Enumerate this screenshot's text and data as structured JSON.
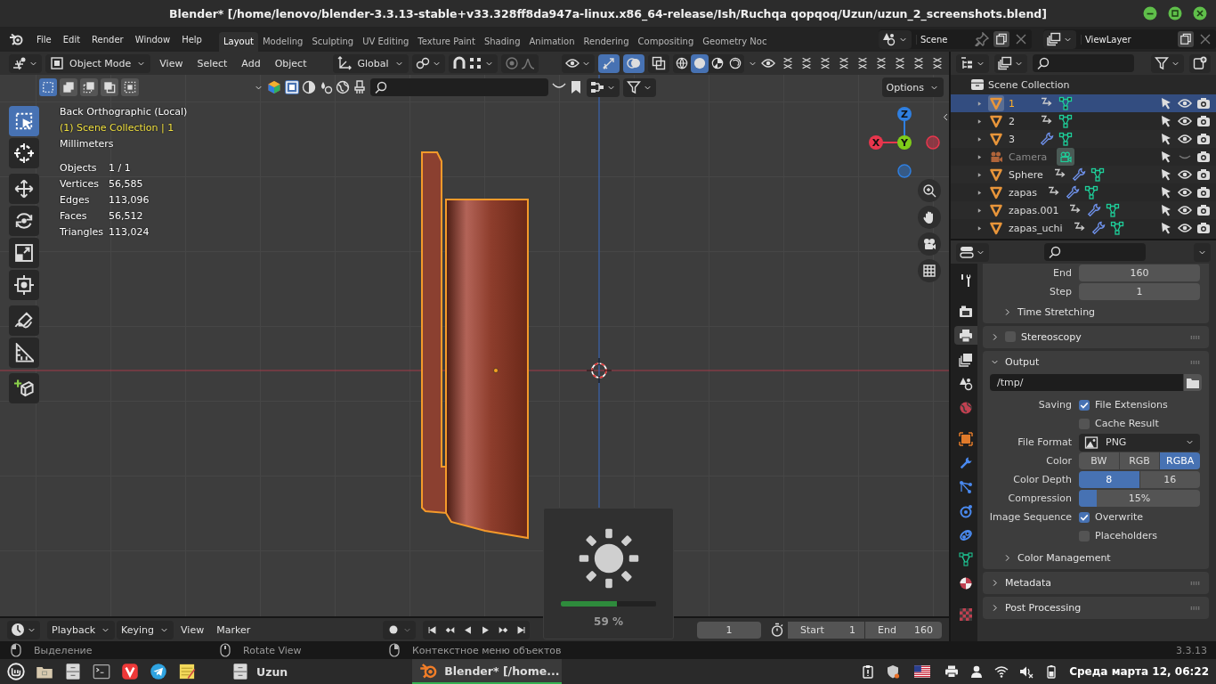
{
  "window": {
    "title": "Blender* [/home/lenovo/blender-3.3.13-stable+v33.328ff8da947a-linux.x86_64-release/Ish/Ruchqa qopqoq/Uzun/uzun_2_screenshots.blend]"
  },
  "menu": [
    "File",
    "Edit",
    "Render",
    "Window",
    "Help"
  ],
  "workspaces": [
    {
      "label": "Layout",
      "selected": true
    },
    {
      "label": "Modeling",
      "selected": false
    },
    {
      "label": "Sculpting",
      "selected": false
    },
    {
      "label": "UV Editing",
      "selected": false
    },
    {
      "label": "Texture Paint",
      "selected": false
    },
    {
      "label": "Shading",
      "selected": false
    },
    {
      "label": "Animation",
      "selected": false
    },
    {
      "label": "Rendering",
      "selected": false
    },
    {
      "label": "Compositing",
      "selected": false
    },
    {
      "label": "Geometry Noc",
      "selected": false
    }
  ],
  "scene": {
    "name": "Scene"
  },
  "view_layer": {
    "name": "ViewLayer"
  },
  "viewport": {
    "mode": "Object Mode",
    "menus": [
      "View",
      "Select",
      "Add",
      "Object"
    ],
    "orientation": "Global",
    "options": "Options",
    "shading": [
      {
        "kind": "wireframe",
        "selected": false
      },
      {
        "kind": "solid",
        "selected": true
      },
      {
        "kind": "material",
        "selected": false
      },
      {
        "kind": "rendered",
        "selected": false
      }
    ],
    "select_modes": [
      {
        "kind": "set",
        "selected": true
      },
      {
        "kind": "extend",
        "selected": false
      },
      {
        "kind": "subtract",
        "selected": false
      },
      {
        "kind": "invert",
        "selected": false
      },
      {
        "kind": "intersect",
        "selected": false
      }
    ],
    "info": {
      "view": "Back Orthographic (Local)",
      "collection": "(1) Scene Collection | 1",
      "units": "Millimeters",
      "stats": [
        {
          "label": "Objects",
          "value": "1 / 1"
        },
        {
          "label": "Vertices",
          "value": "56,585"
        },
        {
          "label": "Edges",
          "value": "113,096"
        },
        {
          "label": "Faces",
          "value": "56,512"
        },
        {
          "label": "Triangles",
          "value": "113,024"
        }
      ]
    },
    "tools": [
      {
        "kind": "select",
        "selected": true
      },
      {
        "kind": "cursor",
        "selected": false
      },
      {
        "kind": "move",
        "selected": false
      },
      {
        "kind": "rotate",
        "selected": false
      },
      {
        "kind": "scale",
        "selected": false
      },
      {
        "kind": "transform",
        "selected": false
      },
      {
        "kind": "annotate",
        "selected": false
      },
      {
        "kind": "measure",
        "selected": false
      },
      {
        "kind": "add_cube",
        "selected": false
      }
    ],
    "gizmo": [
      {
        "kind": "up",
        "label": "Z",
        "color": "#2f7fe0"
      },
      {
        "kind": "left",
        "label": "X",
        "color": "#e8364d"
      },
      {
        "kind": "center",
        "label": "Y",
        "color": "#7fcc1a"
      }
    ]
  },
  "outliner": {
    "root": "Scene Collection",
    "items": [
      {
        "name": "1",
        "kind": "mesh",
        "selected": true,
        "child_link": true,
        "modifiers": false,
        "visible": true
      },
      {
        "name": "2",
        "kind": "mesh",
        "selected": false,
        "child_link": true,
        "modifiers": false,
        "visible": true
      },
      {
        "name": "3",
        "kind": "mesh",
        "selected": false,
        "child_link": false,
        "modifiers": true,
        "visible": true
      },
      {
        "name": "Camera",
        "kind": "camera",
        "selected": false,
        "child_link": false,
        "modifiers": false,
        "visible": false
      },
      {
        "name": "Sphere",
        "kind": "mesh",
        "selected": false,
        "child_link": true,
        "modifiers": true,
        "visible": true
      },
      {
        "name": "zapas",
        "kind": "mesh",
        "selected": false,
        "child_link": true,
        "modifiers": true,
        "visible": true
      },
      {
        "name": "zapas.001",
        "kind": "mesh",
        "selected": false,
        "child_link": true,
        "modifiers": true,
        "visible": true
      },
      {
        "name": "zapas_uchi",
        "kind": "mesh",
        "selected": false,
        "child_link": true,
        "modifiers": true,
        "visible": true
      }
    ]
  },
  "properties": {
    "tabs": [
      {
        "kind": "tool",
        "selected": false
      },
      {
        "kind": "render",
        "selected": false
      },
      {
        "kind": "output",
        "selected": true
      },
      {
        "kind": "view_layer",
        "selected": false
      },
      {
        "kind": "scene",
        "selected": false
      },
      {
        "kind": "world",
        "selected": false
      },
      {
        "kind": "object",
        "selected": false
      },
      {
        "kind": "modifier",
        "selected": false
      },
      {
        "kind": "particles",
        "selected": false
      },
      {
        "kind": "physics",
        "selected": false
      },
      {
        "kind": "constraints",
        "selected": false
      },
      {
        "kind": "data",
        "selected": false
      },
      {
        "kind": "material",
        "selected": false
      },
      {
        "kind": "texture",
        "selected": false
      }
    ],
    "frame_fields": [
      {
        "label": "End",
        "value": "160"
      },
      {
        "label": "Step",
        "value": "1"
      }
    ],
    "time_stretching": {
      "label": "Time Stretching",
      "expanded": false
    },
    "stereoscopy": {
      "label": "Stereoscopy",
      "expanded": false,
      "checked": false
    },
    "output": {
      "label": "Output",
      "expanded": true,
      "path": "/tmp/",
      "saving": {
        "label": "Saving",
        "options": [
          {
            "label": "File Extensions",
            "checked": true
          },
          {
            "label": "Cache Result",
            "checked": false
          }
        ]
      },
      "file_format": {
        "label": "File Format",
        "value": "PNG"
      },
      "color": {
        "label": "Color",
        "options": [
          {
            "label": "BW",
            "selected": false
          },
          {
            "label": "RGB",
            "selected": false
          },
          {
            "label": "RGBA",
            "selected": true
          }
        ]
      },
      "color_depth": {
        "label": "Color Depth",
        "options": [
          {
            "label": "8",
            "selected": true
          },
          {
            "label": "16",
            "selected": false
          }
        ]
      },
      "compression": {
        "label": "Compression",
        "value": "15%",
        "level": 0.15
      },
      "image_sequence": {
        "label": "Image Sequence",
        "options": [
          {
            "label": "Overwrite",
            "checked": true
          },
          {
            "label": "Placeholders",
            "checked": false
          }
        ]
      },
      "color_management": {
        "label": "Color Management",
        "expanded": false
      }
    },
    "panels": [
      {
        "label": "Metadata",
        "expanded": false
      },
      {
        "label": "Post Processing",
        "expanded": false
      }
    ]
  },
  "timeline": {
    "menus": [
      {
        "label": "Playback",
        "kind": "dropdown"
      },
      {
        "label": "Keying",
        "kind": "dropdown"
      },
      {
        "label": "View",
        "kind": "menu"
      },
      {
        "label": "Marker",
        "kind": "menu"
      }
    ],
    "current_frame": "1",
    "start": {
      "label": "Start",
      "value": "1"
    },
    "end": {
      "label": "End",
      "value": "160"
    }
  },
  "osd": {
    "label": "59 %",
    "level": 0.59
  },
  "status_bar": {
    "items": [
      {
        "label": "Выделение",
        "kind": "left"
      },
      {
        "label": "Rotate View",
        "kind": "middle"
      },
      {
        "label": "Контекстное меню объектов",
        "kind": "right"
      }
    ],
    "version": "3.3.13"
  },
  "taskbar": {
    "windows": [
      {
        "label": "Uzun",
        "kind": "files",
        "selected": false
      },
      {
        "label": "Blender* [/home...",
        "kind": "blender",
        "selected": true
      }
    ],
    "clock": "Среда марта 12, 06:22"
  }
}
